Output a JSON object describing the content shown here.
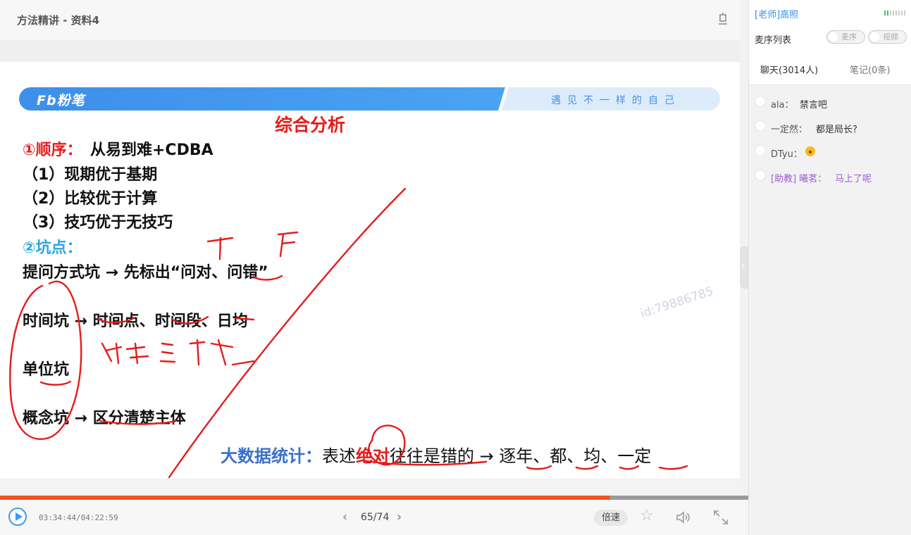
{
  "window": {
    "title": "方法精讲 - 资料4"
  },
  "slide": {
    "logo_text": "Fb粉笔",
    "slogan": "遇见不一样的自己",
    "heading": "综合分析",
    "point1_title": "①顺序：",
    "point1_text": "从易到难+CDBA",
    "lines": [
      "（1）现期优于基期",
      "（2）比较优于计算",
      "（3）技巧优于无技巧"
    ],
    "point2_title": "②坑点：",
    "pit_question": "提问方式坑 → 先标出“问对、问错”",
    "pit_time": "时间坑 → 时间点、时间段、日均",
    "pit_unit": "单位坑",
    "pit_concept": "概念坑 → 区分清楚主体",
    "bottom_label": "大数据统计：",
    "bottom_pre": "表述",
    "bottom_emph": "绝对",
    "bottom_post": "往往是错的 → 逐年、都、均、一定",
    "watermark": "id:79886785",
    "ink_colors": {
      "red": "#e51c1c"
    }
  },
  "player": {
    "progress": 0.815,
    "timecode": "03:34:44/04:22:59",
    "page": "65/74",
    "speed_label": "倍速"
  },
  "side": {
    "teacher": "[老师]高照",
    "mic_list": "麦序列表",
    "mic_toggle": "麦序",
    "video_toggle": "视频",
    "tab_chat": "聊天(3014人)",
    "tab_notes": "笔记(0条)",
    "messages": [
      {
        "name": "ala：",
        "text": "禁言吧"
      },
      {
        "name": "一定然：",
        "text": "都是局长?"
      },
      {
        "name": "DTyu：",
        "text": ""
      },
      {
        "name": "[助教] 曦茗：",
        "text": "马上了呢"
      }
    ]
  },
  "colors": {
    "accent": "#3a9cf0",
    "progress": "#f2531e",
    "assistant": "#a05bd6"
  }
}
